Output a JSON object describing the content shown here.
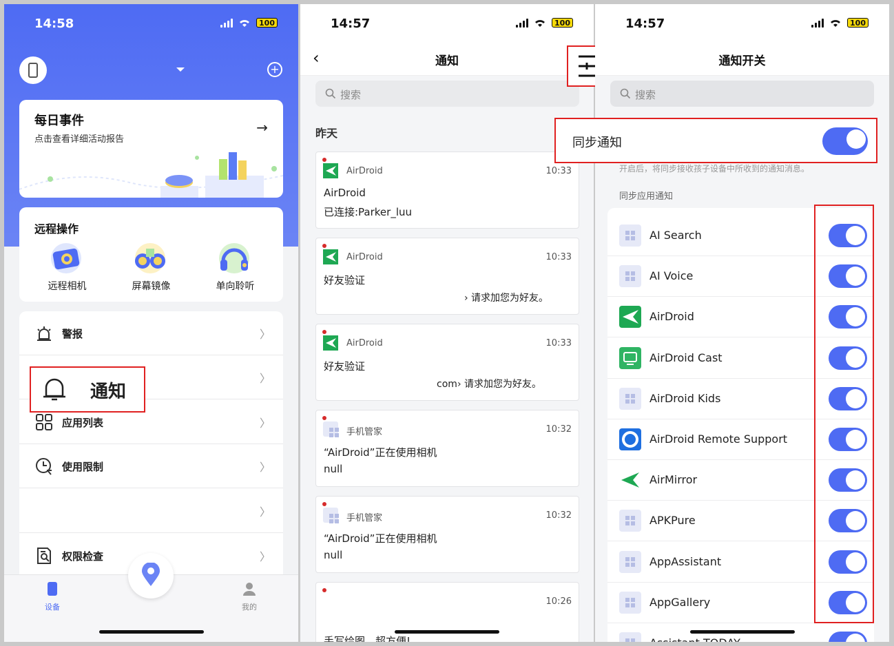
{
  "screen1": {
    "time": "14:58",
    "battery": "100",
    "daily": {
      "title": "每日事件",
      "subtitle": "点击查看详细活动报告"
    },
    "remote": {
      "title": "远程操作",
      "items": [
        {
          "label": "远程相机"
        },
        {
          "label": "屏幕镜像"
        },
        {
          "label": "单向聆听"
        }
      ]
    },
    "menu": [
      {
        "label": "警报"
      },
      {
        "label": "通知"
      },
      {
        "label": "应用列表"
      },
      {
        "label": "使用限制"
      },
      {
        "label": ""
      },
      {
        "label": "权限检查"
      }
    ],
    "tabs": {
      "device": "设备",
      "me": "我的"
    }
  },
  "screen2": {
    "time": "14:57",
    "battery": "100",
    "title": "通知",
    "search_placeholder": "搜索",
    "section": "昨天",
    "items": [
      {
        "app": "AirDroid",
        "time": "10:33",
        "line1": "AirDroid",
        "line2": "已连接:Parker_luu"
      },
      {
        "app": "AirDroid",
        "time": "10:33",
        "line1": "好友验证",
        "line2": "› 请求加您为好友。"
      },
      {
        "app": "AirDroid",
        "time": "10:33",
        "line1": "好友验证",
        "line2": "com› 请求加您为好友。"
      },
      {
        "app": "手机管家",
        "time": "10:32",
        "line1": "“AirDroid”正在使用相机",
        "line2": "null"
      },
      {
        "app": "手机管家",
        "time": "10:32",
        "line1": "“AirDroid”正在使用相机",
        "line2": "null"
      },
      {
        "app": "",
        "time": "10:26",
        "line1": "",
        "line2": "手写绘图，超方便!"
      }
    ]
  },
  "screen3": {
    "time": "14:57",
    "battery": "100",
    "title": "通知开关",
    "search_placeholder": "搜索",
    "sync_label": "同步通知",
    "sync_desc": "开启后，将同步接收孩子设备中所收到的通知消息。",
    "apps_section": "同步应用通知",
    "apps": [
      {
        "name": "AI Search",
        "icon": "generic"
      },
      {
        "name": "AI Voice",
        "icon": "generic"
      },
      {
        "name": "AirDroid",
        "icon": "airdroid"
      },
      {
        "name": "AirDroid Cast",
        "icon": "cast"
      },
      {
        "name": "AirDroid Kids",
        "icon": "generic"
      },
      {
        "name": "AirDroid Remote Support",
        "icon": "support"
      },
      {
        "name": "AirMirror",
        "icon": "airmirror"
      },
      {
        "name": "APKPure",
        "icon": "generic"
      },
      {
        "name": "AppAssistant",
        "icon": "generic"
      },
      {
        "name": "AppGallery",
        "icon": "generic"
      },
      {
        "name": "Assistant TODAY",
        "icon": "generic"
      }
    ]
  },
  "callout": {
    "notify_label": "通知"
  },
  "colors": {
    "accent": "#4e6bf3",
    "highlight": "#e02020"
  }
}
